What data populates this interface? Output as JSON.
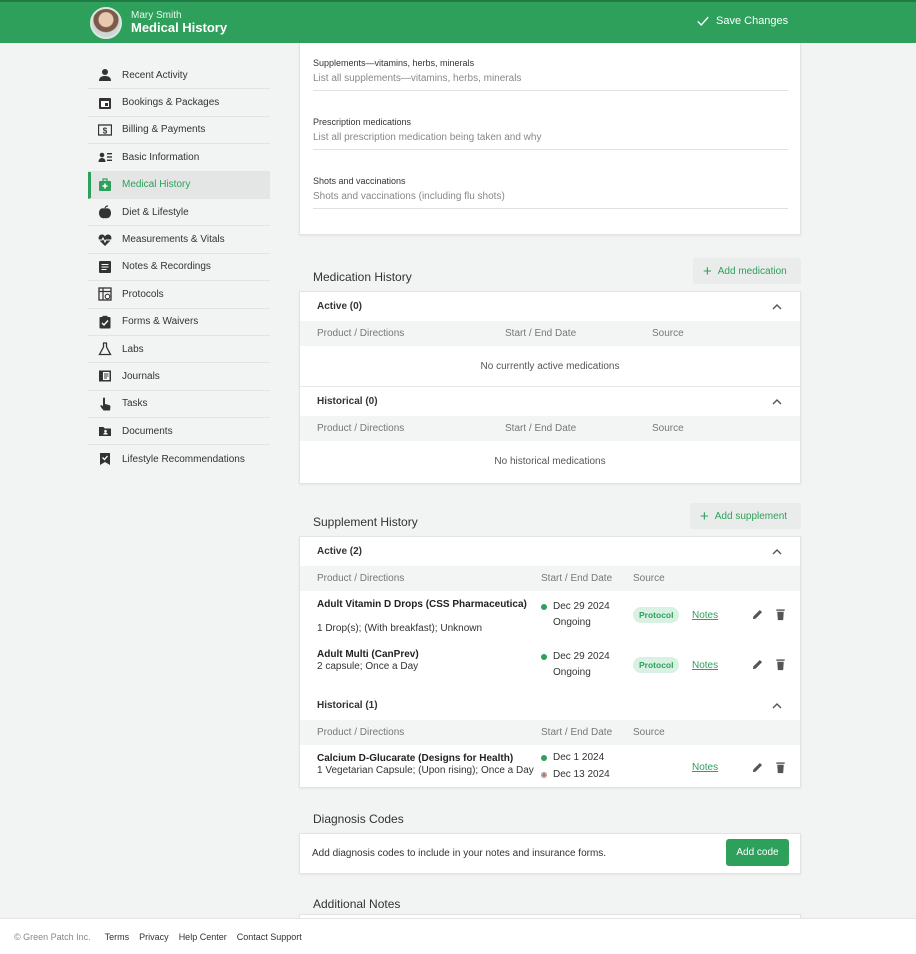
{
  "header": {
    "user_name": "Mary Smith",
    "page_title": "Medical History",
    "save_label": "Save Changes",
    "brand_color": "#2ea05c"
  },
  "sidebar": {
    "items": [
      {
        "label": "Recent Activity",
        "icon": "person-icon"
      },
      {
        "label": "Bookings & Packages",
        "icon": "calendar-icon"
      },
      {
        "label": "Billing & Payments",
        "icon": "dollar-icon"
      },
      {
        "label": "Basic Information",
        "icon": "contact-list-icon"
      },
      {
        "label": "Medical History",
        "icon": "medical-kit-icon",
        "active": true
      },
      {
        "label": "Diet & Lifestyle",
        "icon": "apple-icon"
      },
      {
        "label": "Measurements & Vitals",
        "icon": "heartbeat-icon"
      },
      {
        "label": "Notes & Recordings",
        "icon": "notes-icon"
      },
      {
        "label": "Protocols",
        "icon": "protocol-icon"
      },
      {
        "label": "Forms & Waivers",
        "icon": "clipboard-check-icon"
      },
      {
        "label": "Labs",
        "icon": "flask-icon"
      },
      {
        "label": "Journals",
        "icon": "journal-icon"
      },
      {
        "label": "Tasks",
        "icon": "hand-pointer-icon"
      },
      {
        "label": "Documents",
        "icon": "folder-icon"
      },
      {
        "label": "Lifestyle Recommendations",
        "icon": "bookmark-check-icon"
      }
    ]
  },
  "top_fields": [
    {
      "label": "Supplements—vitamins, herbs, minerals",
      "placeholder": "List all supplements—vitamins, herbs, minerals"
    },
    {
      "label": "Prescription medications",
      "placeholder": "List all prescription medication being taken and why"
    },
    {
      "label": "Shots and vaccinations",
      "placeholder": "Shots and vaccinations (including flu shots)"
    }
  ],
  "columns": {
    "product": "Product / Directions",
    "dates": "Start / End Date",
    "source": "Source"
  },
  "medication_history": {
    "title": "Medication History",
    "add_label": "Add medication",
    "active_title": "Active (0)",
    "active_empty": "No currently active medications",
    "historical_title": "Historical (0)",
    "historical_empty": "No historical medications"
  },
  "supplement_history": {
    "title": "Supplement History",
    "add_label": "Add supplement",
    "active_title": "Active (2)",
    "historical_title": "Historical (1)",
    "active": [
      {
        "name": "Adult Vitamin D Drops (CSS Pharmaceutica)",
        "directions": "1 Drop(s); (With breakfast); Unknown",
        "start": "Dec 29 2024",
        "end": "Ongoing",
        "source": "Protocol",
        "notes": "Notes"
      },
      {
        "name": "Adult Multi (CanPrev)",
        "directions": "2 capsule; Once a Day",
        "start": "Dec 29 2024",
        "end": "Ongoing",
        "source": "Protocol",
        "notes": "Notes"
      }
    ],
    "historical": [
      {
        "name": "Calcium D-Glucarate (Designs for Health)",
        "directions": "1 Vegetarian Capsule; (Upon rising); Once a Day",
        "start": "Dec 1 2024",
        "end": "Dec 13 2024",
        "notes": "Notes"
      }
    ]
  },
  "diagnosis": {
    "title": "Diagnosis Codes",
    "text": "Add diagnosis codes to include in your notes and insurance forms.",
    "button": "Add code"
  },
  "additional_notes": {
    "title": "Additional Notes"
  },
  "footer": {
    "copyright": "© Green Patch Inc.",
    "links": [
      "Terms",
      "Privacy",
      "Help Center",
      "Contact Support"
    ]
  }
}
